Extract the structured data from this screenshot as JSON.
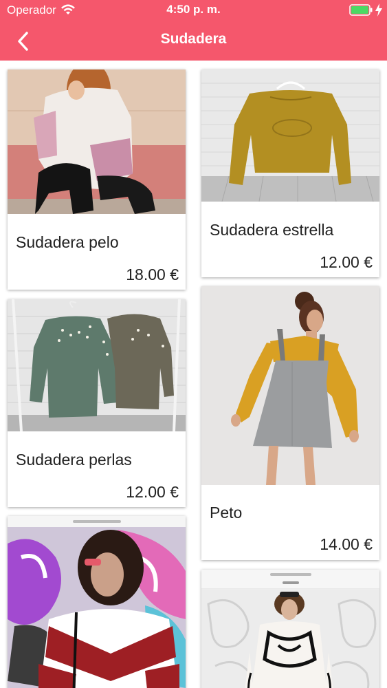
{
  "status_bar": {
    "carrier": "Operador",
    "time": "4:50 p. m."
  },
  "nav": {
    "title": "Sudadera"
  },
  "colors": {
    "accent": "#f5576c",
    "battery": "#4cd964"
  },
  "products": [
    {
      "title": "Sudadera pelo",
      "price": "18.00 €"
    },
    {
      "title": "Sudadera estrella",
      "price": "12.00 €"
    },
    {
      "title": "Sudadera perlas",
      "price": "12.00 €"
    },
    {
      "title": "Peto",
      "price": "14.00 €"
    }
  ]
}
